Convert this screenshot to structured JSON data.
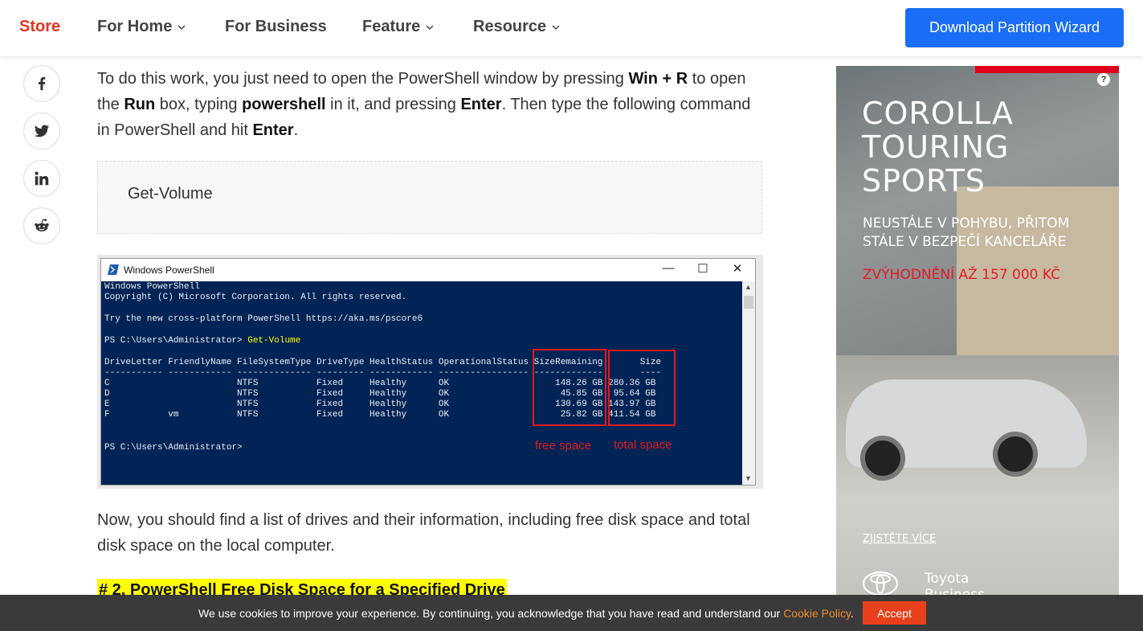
{
  "nav": {
    "store": "Store",
    "for_home": "For Home",
    "for_business": "For Business",
    "feature": "Feature",
    "resource": "Resource",
    "download_button": "Download Partition Wizard"
  },
  "social": [
    "facebook-icon",
    "twitter-icon",
    "linkedin-icon",
    "reddit-icon"
  ],
  "article": {
    "para1_a": "To do this work, you just need to open the PowerShell window by pressing ",
    "para1_b1": "Win + R",
    "para1_c": " to open the ",
    "para1_b2": "Run",
    "para1_d": " box, typing ",
    "para1_b3": "powershell",
    "para1_e": " in it, and pressing ",
    "para1_b4": "Enter",
    "para1_f": ". Then type the following command in PowerShell and hit ",
    "para1_b5": "Enter",
    "para1_g": ".",
    "code": "Get-Volume",
    "para2": "Now, you should find a list of drives and their information, including free disk space and total disk space on the local computer.",
    "heading": "# 2. PowerShell Free Disk Space for a Specified Drive"
  },
  "screenshot": {
    "window_title": "Windows PowerShell",
    "lines": [
      "Windows PowerShell",
      "Copyright (C) Microsoft Corporation. All rights reserved.",
      "",
      "Try the new cross-platform PowerShell https://aka.ms/pscore6",
      "",
      "PS C:\\Users\\Administrator> ",
      "",
      "DriveLetter FriendlyName FileSystemType DriveType HealthStatus OperationalStatus SizeRemaining       Size",
      "----------- ------------ -------------- --------- ------------ ----------------- -------------       ----",
      "C                        NTFS           Fixed     Healthy      OK                    148.26 GB 280.36 GB",
      "D                        NTFS           Fixed     Healthy      OK                     45.85 GB  95.64 GB",
      "E                        NTFS           Fixed     Healthy      OK                    130.69 GB 143.97 GB",
      "F           vm           NTFS           Fixed     Healthy      OK                     25.82 GB 411.54 GB",
      "",
      "",
      "PS C:\\Users\\Administrator>"
    ],
    "command": "Get-Volume",
    "label_free": "free space",
    "label_total": "total space"
  },
  "ad": {
    "title1": "COROLLA",
    "title2": "TOURING",
    "title3": "SPORTS",
    "sub1": "NEUSTÁLE V POHYBU, PŘITOM",
    "sub2": "STÁLE V BEZPEČÍ KANCELÁŘE",
    "promo": "ZVÝHODNĚNÍ AŽ 157 000 KČ",
    "cta": "ZJISTĚTE VÍCE",
    "brand1": "Toyota",
    "brand2": "Business",
    "help": "?"
  },
  "cookie": {
    "message": "We use cookies to improve your experience. By continuing, you acknowledge that you have read and understand our ",
    "link": "Cookie Policy",
    "end": ".",
    "accept": "Accept"
  }
}
